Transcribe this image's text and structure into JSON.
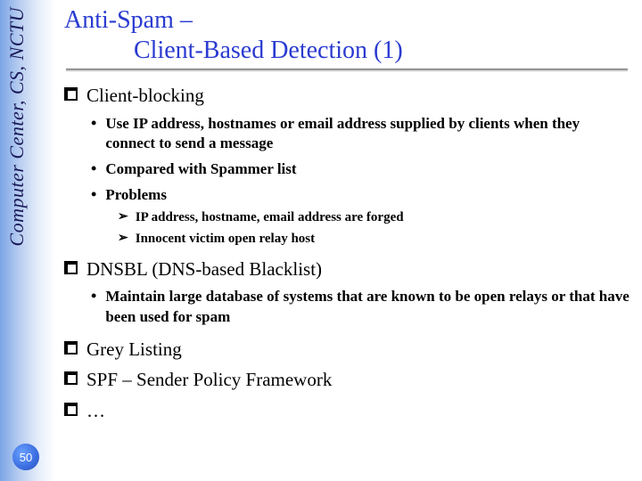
{
  "sidebar": {
    "label": "Computer Center, CS, NCTU",
    "page_number": "50"
  },
  "title": {
    "line1": "Anti-Spam –",
    "line2": "Client-Based Detection (1)"
  },
  "items": [
    {
      "text": "Client-blocking",
      "bullets": [
        {
          "text": "Use IP address, hostnames or email address supplied by clients when they connect to send a message"
        },
        {
          "text": "Compared with Spammer list"
        },
        {
          "text": "Problems",
          "subs": [
            "IP address, hostname, email address are forged",
            "Innocent victim open relay host"
          ]
        }
      ]
    },
    {
      "text": "DNSBL (DNS-based Blacklist)",
      "bullets": [
        {
          "text": "Maintain large database of systems that are known to be open relays or that have been used for spam"
        }
      ]
    },
    {
      "text": "Grey Listing"
    },
    {
      "text": "SPF – Sender Policy Framework"
    },
    {
      "text": "…"
    }
  ]
}
